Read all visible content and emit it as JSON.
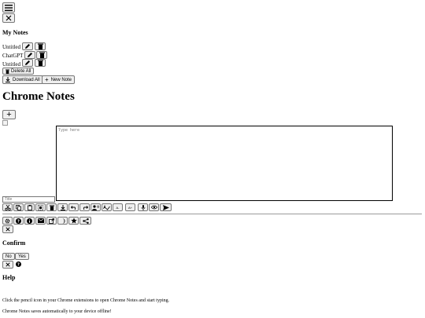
{
  "sidebar": {
    "heading": "My Notes",
    "notes": [
      {
        "title": "Untitled"
      },
      {
        "title": "ChatGPT"
      },
      {
        "title": "Untitled"
      }
    ],
    "delete_all_label": "Delete All",
    "download_all_label": "Download All",
    "new_note_label": "New Note"
  },
  "main": {
    "title": "Chrome Notes",
    "editor_placeholder": "Type here",
    "title_placeholder": "Title"
  },
  "confirm": {
    "heading": "Confirm",
    "no_label": "No",
    "yes_label": "Yes"
  },
  "help": {
    "heading": "Help",
    "line1": "Click the pencil icon in your Chrome extensions to open Chrome Notes and start typing.",
    "line2": "Chrome Notes saves automatically to your device offline!"
  },
  "toolbar_small_text": {
    "decrease": "A-",
    "increase": "A+"
  }
}
